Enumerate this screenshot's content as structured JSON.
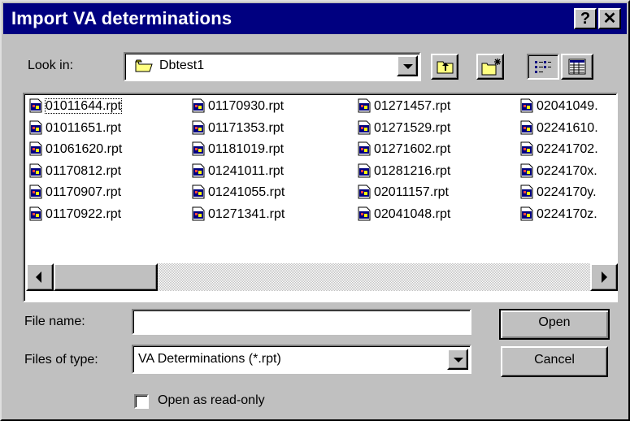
{
  "window": {
    "title": "Import VA determinations",
    "help_label": "?",
    "close_label": "✕"
  },
  "look_in": {
    "label": "Look in:",
    "value": "Dbtest1",
    "icon": "folder-icon"
  },
  "toolbar": {
    "up_one_level_icon": "up-folder-icon",
    "new_folder_icon": "new-folder-icon",
    "list_view_icon": "list-view-icon",
    "details_view_icon": "details-view-icon"
  },
  "files": {
    "columns": [
      [
        "01011644.rpt",
        "01011651.rpt",
        "01061620.rpt",
        "01170812.rpt",
        "01170907.rpt",
        "01170922.rpt"
      ],
      [
        "01170930.rpt",
        "01171353.rpt",
        "01181019.rpt",
        "01241011.rpt",
        "01241055.rpt",
        "01271341.rpt"
      ],
      [
        "01271457.rpt",
        "01271529.rpt",
        "01271602.rpt",
        "01281216.rpt",
        "02011157.rpt",
        "02041048.rpt"
      ],
      [
        "02041049.",
        "02241610.",
        "02241702.",
        "0224170x.",
        "0224170y.",
        "0224170z."
      ]
    ],
    "file_icon": "report-file-icon"
  },
  "file_name": {
    "label": "File name:",
    "value": ""
  },
  "files_of_type": {
    "label": "Files of type:",
    "value": "VA Determinations (*.rpt)"
  },
  "read_only": {
    "label": "Open as read-only",
    "checked": false
  },
  "buttons": {
    "open": "Open",
    "cancel": "Cancel"
  }
}
